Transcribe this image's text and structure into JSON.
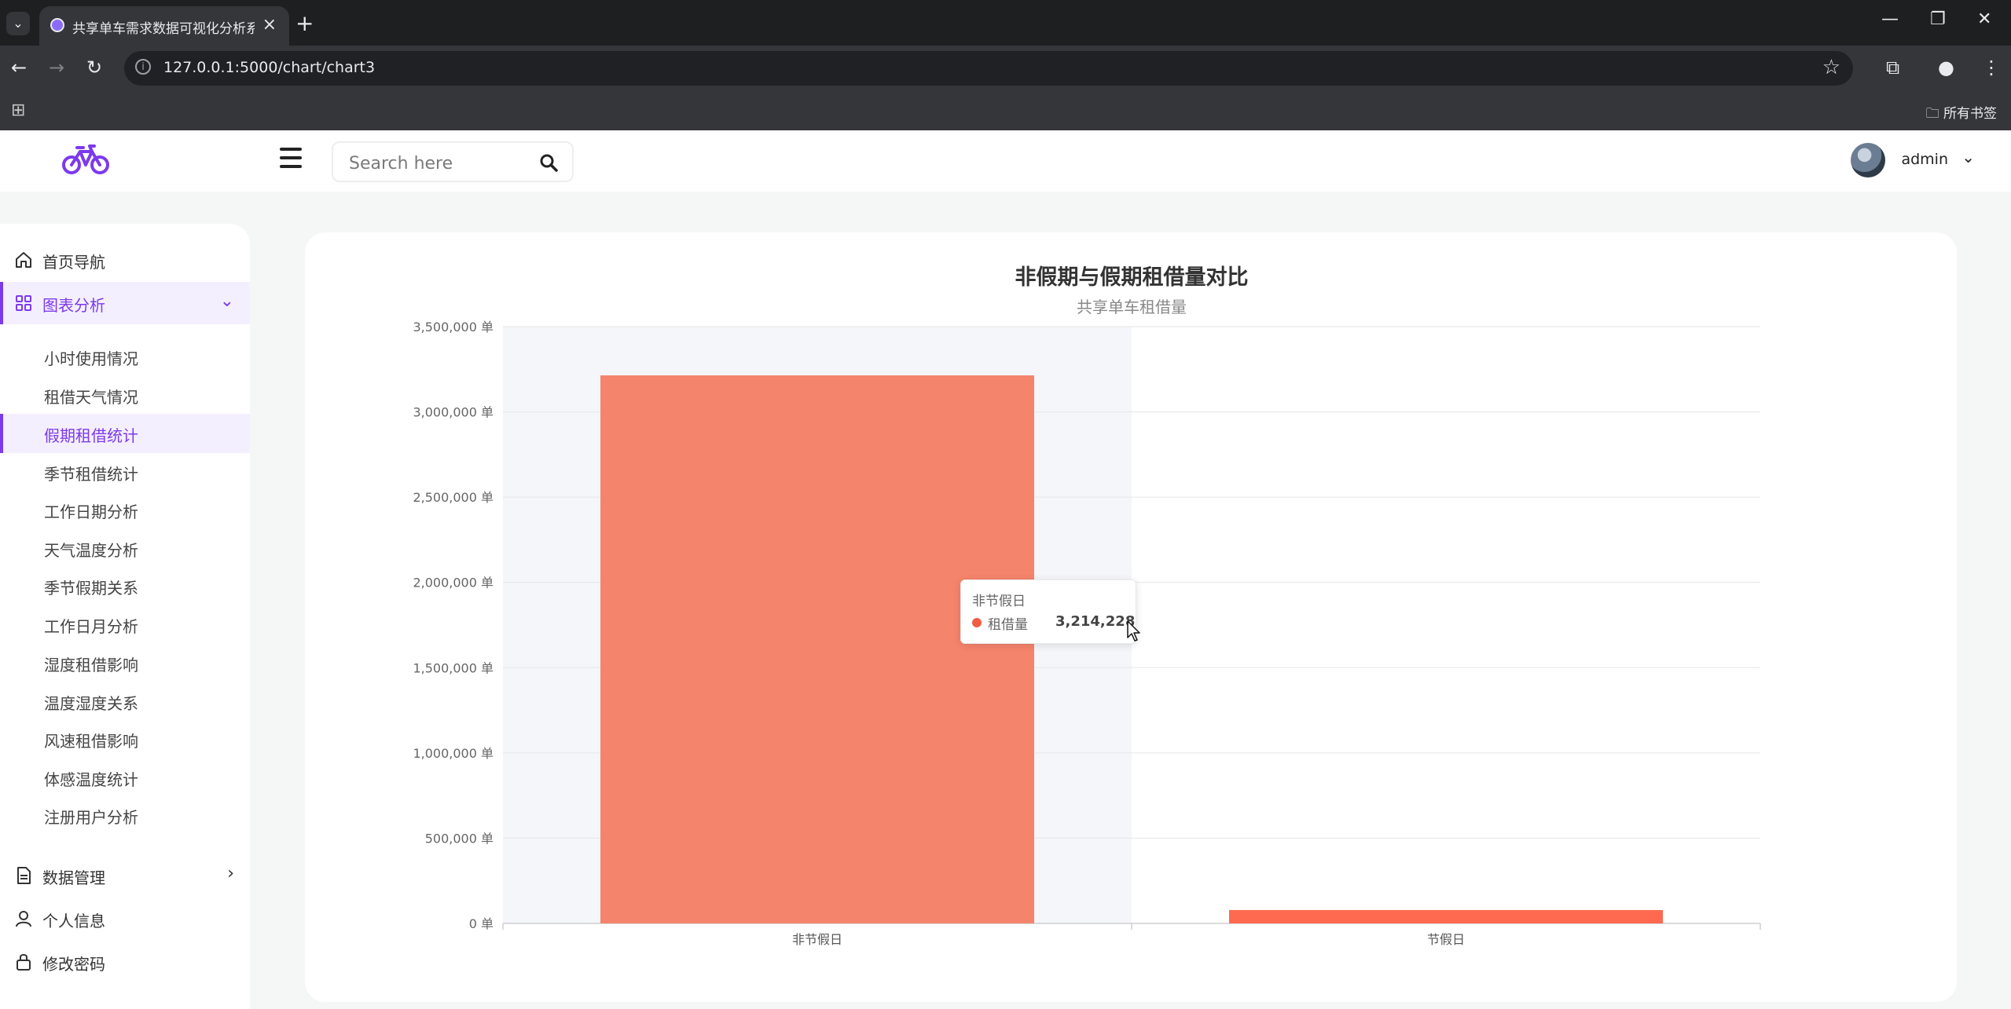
{
  "browser": {
    "tab_title": "共享单车需求数据可视化分析系统",
    "url": "127.0.0.1:5000/chart/chart3",
    "bookmarks_label": "所有书签"
  },
  "header": {
    "search_placeholder": "Search here",
    "username": "admin"
  },
  "sidebar": {
    "items": [
      {
        "label": "首页导航",
        "icon": "home-icon"
      },
      {
        "label": "图表分析",
        "icon": "grid-icon"
      },
      {
        "label": "数据管理",
        "icon": "document-icon"
      },
      {
        "label": "个人信息",
        "icon": "user-icon"
      },
      {
        "label": "修改密码",
        "icon": "lock-icon"
      }
    ],
    "submenu": [
      "小时使用情况",
      "租借天气情况",
      "假期租借统计",
      "季节租借统计",
      "工作日期分析",
      "天气温度分析",
      "季节假期关系",
      "工作日月分析",
      "湿度租借影响",
      "温度湿度关系",
      "风速租借影响",
      "体感温度统计",
      "注册用户分析"
    ],
    "active_submenu": "假期租借统计"
  },
  "chart_data": {
    "type": "bar",
    "title": "非假期与假期租借量对比",
    "subtitle": "共享单车租借量",
    "categories": [
      "非节假日",
      "节假日"
    ],
    "series": [
      {
        "name": "租借量",
        "values": [
          3214228,
          78435
        ]
      }
    ],
    "ylim": [
      0,
      3500000
    ],
    "yticks": [
      0,
      500000,
      1000000,
      1500000,
      2000000,
      2500000,
      3000000,
      3500000
    ],
    "ytick_labels": [
      "0 单",
      "500,000 单",
      "1,000,000 单",
      "1,500,000 单",
      "2,000,000 单",
      "2,500,000 单",
      "3,000,000 单",
      "3,500,000 单"
    ],
    "bar_colors": [
      "#f5846c",
      "#fd6a50"
    ],
    "grid": true,
    "highlight_category": "非节假日"
  },
  "tooltip": {
    "title": "非节假日",
    "series": "租借量",
    "value": "3,214,228",
    "color": "#f25c44"
  }
}
